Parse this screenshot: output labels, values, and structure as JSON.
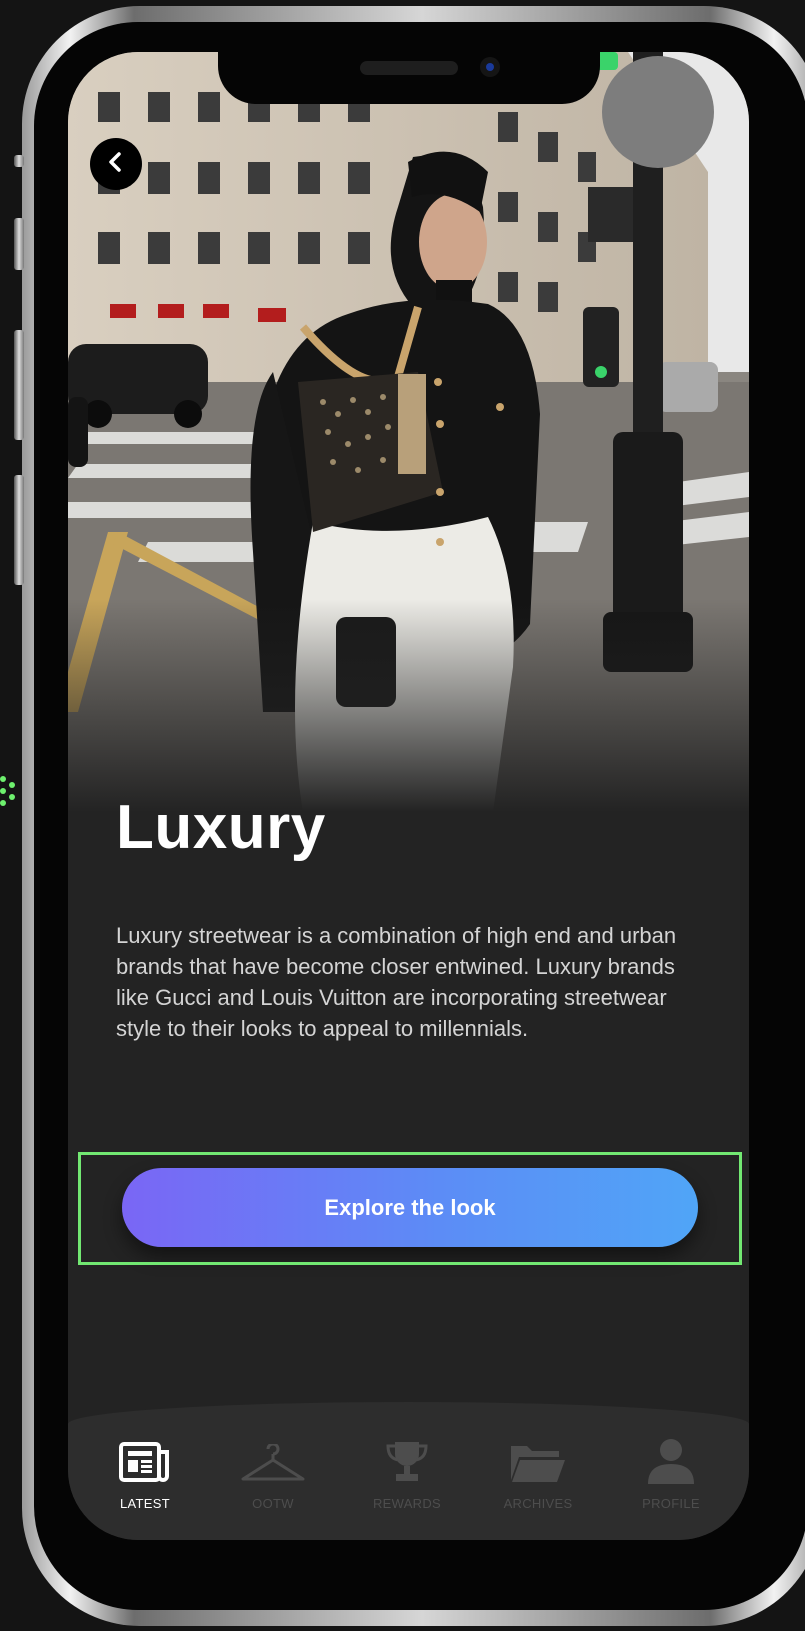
{
  "article": {
    "title": "Luxury",
    "description": "Luxury streetwear is a combination of high end and urban brands that have become closer entwined. Luxury brands like Gucci and Louis Vuitton are incorporating streetwear style to their looks to appeal to millennials."
  },
  "cta": {
    "label": "Explore the look"
  },
  "tabs": [
    {
      "label": "LATEST",
      "icon": "newspaper-icon",
      "active": true
    },
    {
      "label": "OOTW",
      "icon": "hanger-icon",
      "active": false
    },
    {
      "label": "REWARDS",
      "icon": "trophy-icon",
      "active": false
    },
    {
      "label": "ARCHIVES",
      "icon": "folder-icon",
      "active": false
    },
    {
      "label": "PROFILE",
      "icon": "person-icon",
      "active": false
    }
  ],
  "colors": {
    "background": "#232323",
    "cta_gradient_start": "#7a66f5",
    "cta_gradient_end": "#50a5f7",
    "highlight": "#72e872",
    "tab_active": "#ffffff",
    "tab_inactive": "#4d4d4d"
  }
}
